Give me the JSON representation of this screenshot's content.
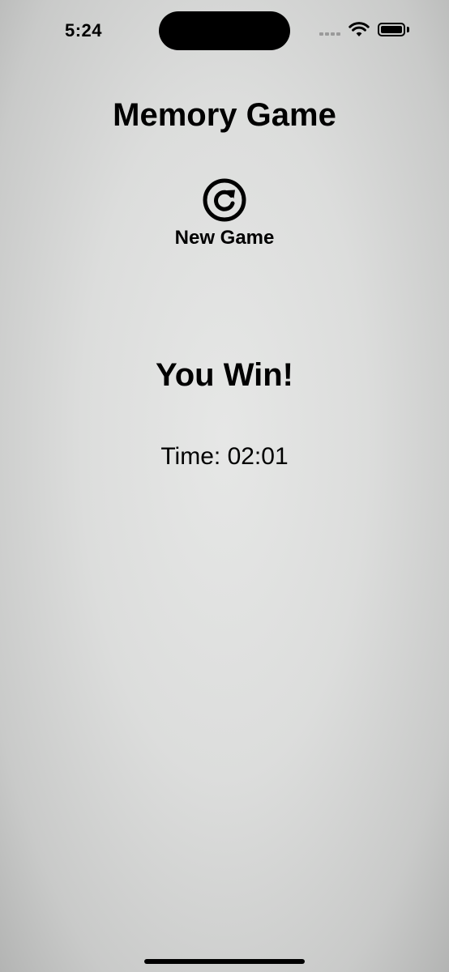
{
  "status_bar": {
    "time": "5:24",
    "icons": [
      "signal-icon",
      "wifi-icon",
      "battery-icon"
    ]
  },
  "title": "Memory Game",
  "new_game": {
    "icon": "refresh-icon",
    "label": "New Game"
  },
  "result": {
    "message": "You Win!",
    "time_text": "Time: 02:01"
  }
}
